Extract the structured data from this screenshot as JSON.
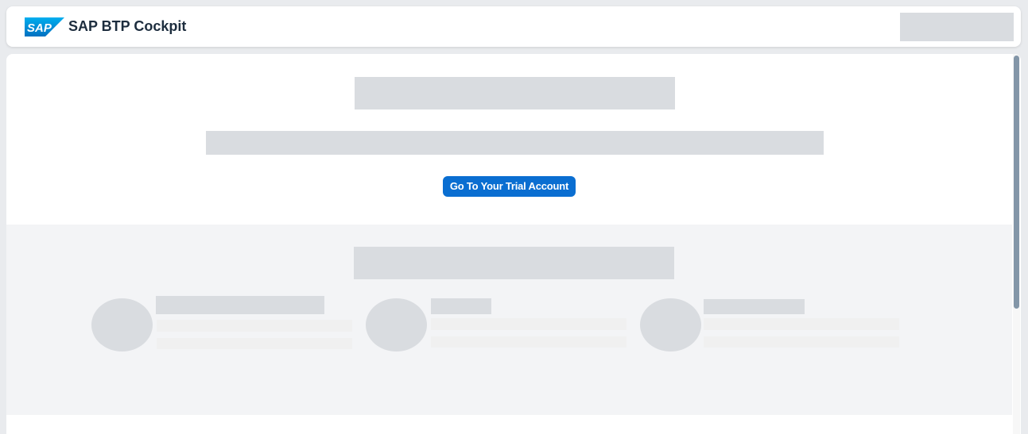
{
  "shellbar": {
    "logo_text": "SAP",
    "title": "SAP BTP Cockpit"
  },
  "hero": {
    "cta_label": "Go To Your Trial Account"
  },
  "colors": {
    "brand_blue": "#0a6ed1",
    "placeholder": "#d9dce0",
    "band_bg": "#f3f4f6",
    "title_text": "#1d2d3e"
  },
  "feature_cards": [
    {
      "icon": "placeholder-avatar"
    },
    {
      "icon": "placeholder-avatar"
    },
    {
      "icon": "placeholder-avatar"
    }
  ]
}
